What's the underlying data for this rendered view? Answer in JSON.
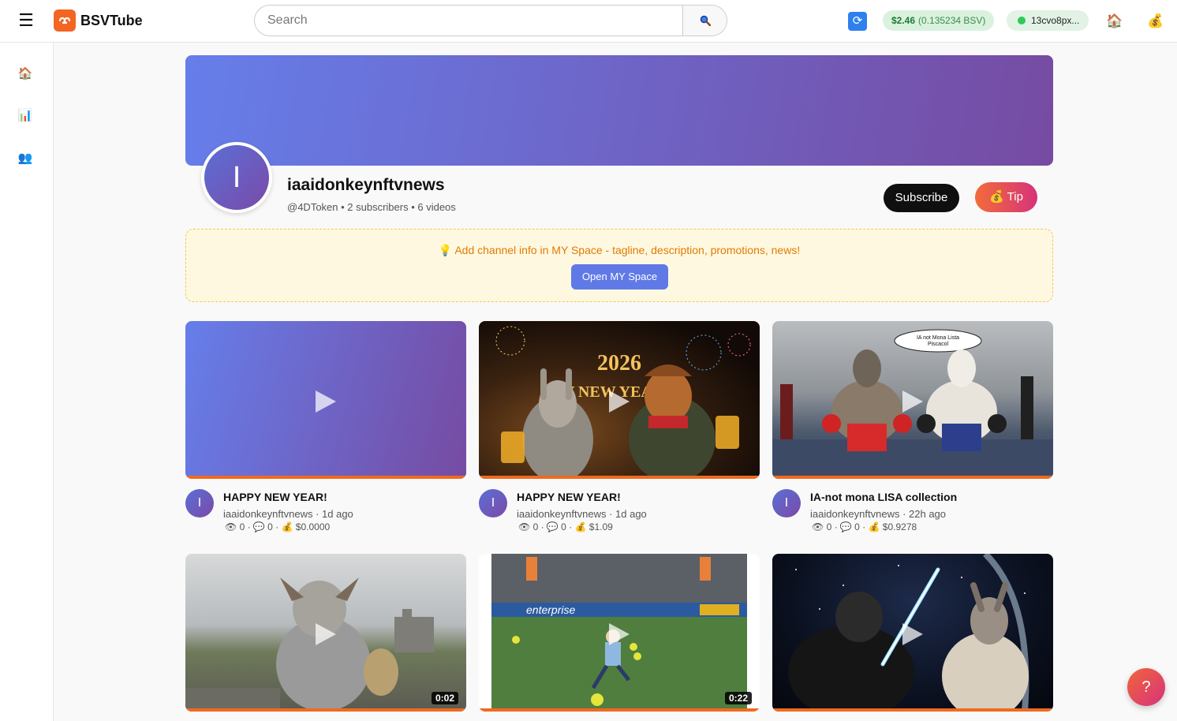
{
  "header": {
    "logo_mark": "GB",
    "logo_text": "BSVTube",
    "search_placeholder": "Search",
    "balance_usd": "$2.46",
    "balance_bsv": "(0.135234 BSV)",
    "wallet_address": "13cvo8px..."
  },
  "channel": {
    "avatar_letter": "I",
    "name": "iaaidonkeynftvnews",
    "meta": "@4DToken • 2 subscribers • 6 videos",
    "subscribe_label": "Subscribe",
    "tip_label": "💰 Tip"
  },
  "notice": {
    "text": "💡 Add channel info in MY Space - tagline, description, promotions, news!",
    "button_label": "Open MY Space"
  },
  "videos": [
    {
      "title": "HAPPY NEW YEAR!",
      "channel_time": "iaaidonkeynftvnews · 1d ago",
      "stats": "👁 0 · 💬 0 · 💰 $0.0000",
      "avatar_letter": "I",
      "duration": "",
      "thumb": "gradient"
    },
    {
      "title": "HAPPY NEW YEAR!",
      "channel_time": "iaaidonkeynftvnews · 1d ago",
      "stats": "👁 0 · 💬 0 · 💰 $1.09",
      "avatar_letter": "I",
      "duration": "",
      "thumb": "new-year-donkeys"
    },
    {
      "title": "IA-not mona LISA collection",
      "channel_time": "iaaidonkeynftvnews · 22h ago",
      "stats": "👁 0 · 💬 0 · 💰 $0.9278",
      "avatar_letter": "I",
      "duration": "",
      "thumb": "boxing-donkeys",
      "thumb_caption": "IA not Mona Lista Piscacol"
    },
    {
      "title": "",
      "channel_time": "",
      "stats": "",
      "avatar_letter": "",
      "duration": "0:02",
      "thumb": "knight-donkey"
    },
    {
      "title": "",
      "channel_time": "",
      "stats": "",
      "avatar_letter": "",
      "duration": "0:22",
      "thumb": "football-match"
    },
    {
      "title": "",
      "channel_time": "",
      "stats": "",
      "avatar_letter": "",
      "duration": "",
      "thumb": "jedi-donkeys"
    }
  ],
  "colors": {
    "accent_orange": "#f26522",
    "banner_start": "#667eea",
    "banner_end": "#764ba2",
    "progress_bar": "#f06a1f",
    "wallet_dot": "#2ec95c"
  },
  "icons": {
    "menu": "hamburger-icon",
    "search": "search-icon",
    "refresh": "refresh-icon",
    "home": "home-icon",
    "wallet": "money-bag-icon",
    "sidebar": [
      "home-icon",
      "chart-icon",
      "people-icon"
    ],
    "help": "help-icon"
  }
}
